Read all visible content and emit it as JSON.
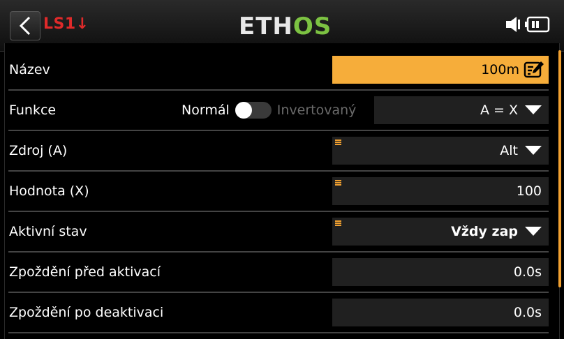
{
  "header": {
    "title": "LS1",
    "title_suffix": "↓",
    "logo_part1": "ETH",
    "logo_part2": "OS"
  },
  "rows": [
    {
      "label": "Název",
      "value": "100m"
    },
    {
      "label": "Funkce",
      "option_normal": "Normál",
      "option_inverted": "Invertovaný",
      "value": "A = X"
    },
    {
      "label": "Zdroj (A)",
      "value": "Alt"
    },
    {
      "label": "Hodnota (X)",
      "value": "100"
    },
    {
      "label": "Aktivní stav",
      "value": "Vždy zap"
    },
    {
      "label": "Zpoždění před aktivací",
      "value": "0.0s"
    },
    {
      "label": "Zpoždění po deaktivaci",
      "value": "0.0s"
    }
  ],
  "colors": {
    "accent": "#f6ad3a",
    "title_red": "#e02a2a",
    "logo_green": "#7cc242"
  },
  "icons": [
    "back-arrow-icon",
    "speaker-icon",
    "battery-icon",
    "edit-icon",
    "dropdown-arrow-icon",
    "source-icon"
  ]
}
